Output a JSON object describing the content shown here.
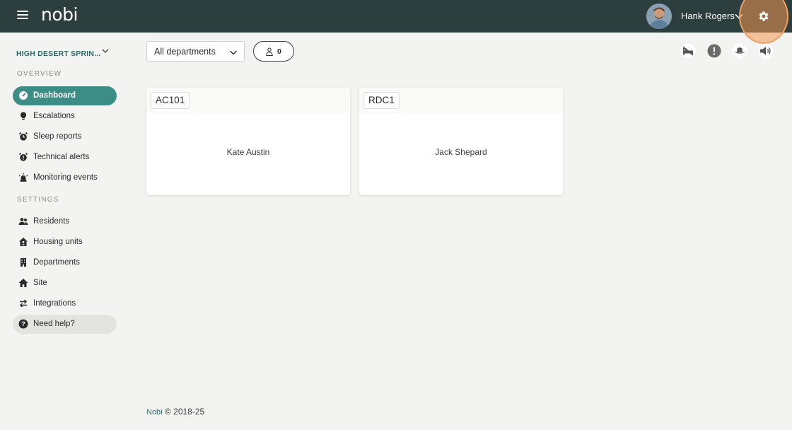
{
  "header": {
    "logo_text": "nobi",
    "user_name": "Hank Rogers",
    "bg_color": "#2d3e3e"
  },
  "sidebar": {
    "site_name": "HIGH DESERT SPRIN...",
    "overview_label": "OVERVIEW",
    "settings_label": "SETTINGS",
    "overview_items": [
      {
        "label": "Dashboard",
        "icon": "gauge-icon",
        "active": true
      },
      {
        "label": "Escalations",
        "icon": "lightbulb-icon"
      },
      {
        "label": "Sleep reports",
        "icon": "alarm-clock-icon"
      },
      {
        "label": "Technical alerts",
        "icon": "alarm-clock-alert-icon"
      },
      {
        "label": "Monitoring events",
        "icon": "siren-icon"
      }
    ],
    "settings_items": [
      {
        "label": "Residents",
        "icon": "users-icon"
      },
      {
        "label": "Housing units",
        "icon": "house-user-icon"
      },
      {
        "label": "Departments",
        "icon": "building-icon"
      },
      {
        "label": "Site",
        "icon": "home-icon"
      },
      {
        "label": "Integrations",
        "icon": "arrows-exchange-icon"
      }
    ],
    "help_label": "Need help?",
    "accent_color": "#3c8d86"
  },
  "toolbar": {
    "department_value": "All departments",
    "resident_count": "0"
  },
  "rooms": [
    {
      "room": "AC101",
      "resident": "Kate Austin"
    },
    {
      "room": "RDC1",
      "resident": "Jack Shepard"
    }
  ],
  "footer": {
    "brand": "Nobi",
    "copyright": "© 2018-25"
  }
}
